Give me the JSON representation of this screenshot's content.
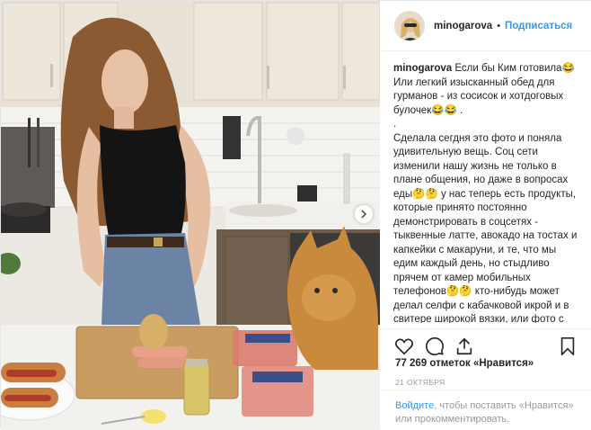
{
  "header": {
    "username": "minogarova",
    "separator": "•",
    "follow_label": "Подписаться"
  },
  "caption": {
    "username": "minogarova",
    "line1": " Если бы Ким готовила😂 Или легкий изысканный обед для гурманов - из сосисок и хотдоговых булочек😂😂 .",
    "line2": ".",
    "body": "Сделала сегдня это фото и поняла удивительную вещь. Соц сети изменили нашу жизнь не только в плане общения, но даже в вопросах еды🤔🤔 у нас теперь есть продукты, которые принято постоянно демонстрировать в соцсетях - тыквенные латте, авокадо на тостах и капкейки с макаруни, и те, что мы едим каждый день, но стыдливо прячем от камер мобильных телефонов🤔🤔 кто-нибудь может делал селфи с кабачковой икрой и в свитере широкой вязки, или фото с костромским сыром, сидя у камина😂 Как будто все люди России только и делают что первым делом по утрам заваривают матчу и перетирают"
  },
  "stats": {
    "likes": "77 269 отметок «Нравится»",
    "date": "21 ОКТЯБРЯ"
  },
  "comment": {
    "login_label": "Войдите",
    "rest": ", чтобы поставить «Нравится» или прокомментировать."
  },
  "icons": {
    "like": "heart-icon",
    "comment": "comment-icon",
    "share": "share-icon",
    "save": "bookmark-icon",
    "next": "chevron-right-icon"
  },
  "colors": {
    "accent": "#3897f0",
    "text": "#262626",
    "muted": "#999999"
  }
}
